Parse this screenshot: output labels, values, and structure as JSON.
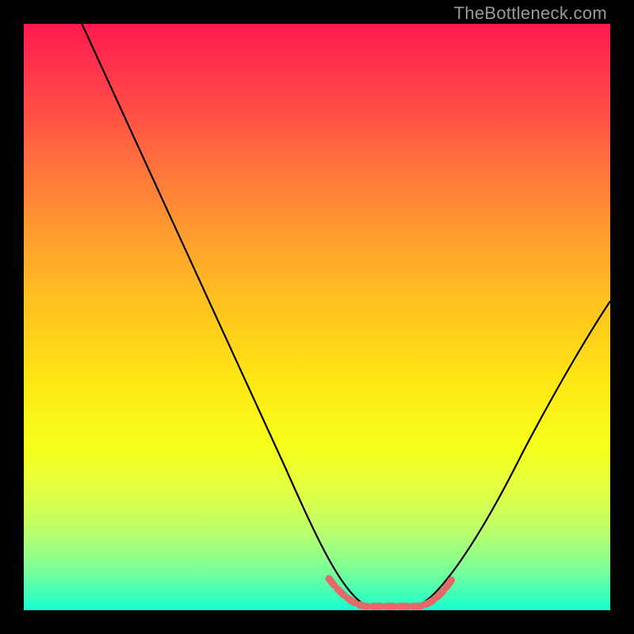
{
  "watermark": "TheBottleneck.com",
  "accent_curve_color": "#e46a69",
  "curve_color": "#000000",
  "chart_data": {
    "type": "line",
    "title": "",
    "xlabel": "",
    "ylabel": "",
    "xlim": [
      0,
      100
    ],
    "ylim": [
      0,
      100
    ],
    "series": [
      {
        "name": "bottleneck-curve",
        "x": [
          0,
          5,
          10,
          15,
          20,
          25,
          30,
          35,
          40,
          45,
          50,
          53,
          55,
          58,
          60,
          63,
          65,
          68,
          70,
          75,
          80,
          85,
          90,
          95,
          100
        ],
        "values": [
          105,
          96,
          88,
          80,
          72,
          64,
          55,
          47,
          38,
          29,
          19,
          11,
          6,
          2,
          0,
          0,
          0,
          2,
          5,
          12,
          21,
          31,
          40,
          47,
          52
        ]
      }
    ],
    "optimal_range_x": [
      55,
      70
    ]
  }
}
